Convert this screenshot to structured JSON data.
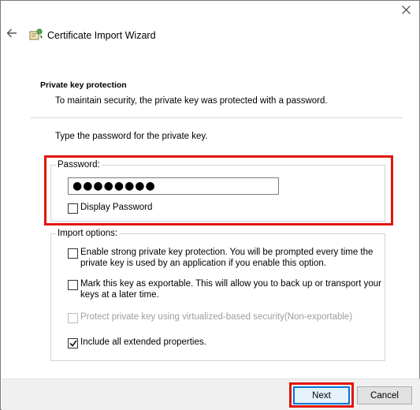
{
  "window": {
    "title": "Certificate Import Wizard",
    "close_icon": "close-icon",
    "back_icon": "back-arrow-icon",
    "app_icon": "certificate-wizard-icon"
  },
  "header": {
    "section_title": "Private key protection",
    "section_desc": "To maintain security, the private key was protected with a password."
  },
  "password": {
    "prompt": "Type the password for the private key.",
    "group_label": "Password:",
    "value": "●●●●●●●●",
    "display_password_label": "Display Password",
    "display_password_checked": false
  },
  "import_options": {
    "group_label": "Import options:",
    "options": [
      {
        "label_line1": "Enable strong private key protection. You will be prompted every time the",
        "label_line2": "private key is used by an application if you enable this option.",
        "checked": false,
        "disabled": false
      },
      {
        "label_line1": "Mark this key as exportable. This will allow you to back up or transport your",
        "label_line2": "keys at a later time.",
        "checked": false,
        "disabled": false
      },
      {
        "label_line1": "Protect private key using virtualized-based security(Non-exportable)",
        "label_line2": "",
        "checked": false,
        "disabled": true
      },
      {
        "label_line1": "Include all extended properties.",
        "label_line2": "",
        "checked": true,
        "disabled": false
      }
    ]
  },
  "footer": {
    "next_label": "Next",
    "cancel_label": "Cancel"
  },
  "colors": {
    "highlight": "#e2160a",
    "focus": "#0078d7"
  }
}
